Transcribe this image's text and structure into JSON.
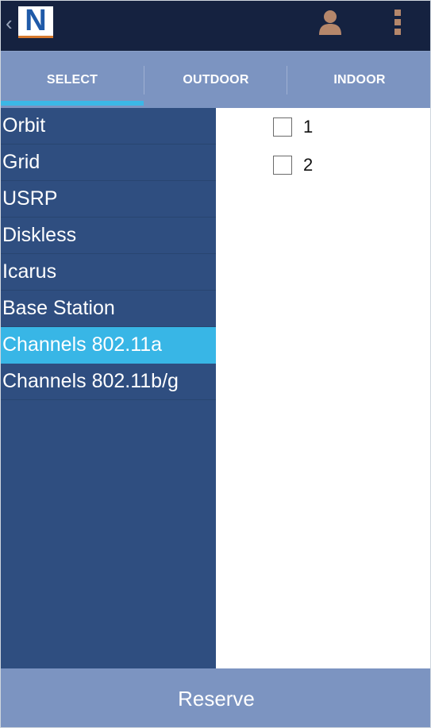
{
  "actionbar": {
    "logo_letter": "N",
    "up_glyph": "‹",
    "icons": {
      "up": "chevron-left-icon",
      "logo": "app-logo",
      "user": "user-icon",
      "overflow": "overflow-menu-icon"
    }
  },
  "tabs": [
    {
      "label": "SELECT",
      "selected": true
    },
    {
      "label": "OUTDOOR",
      "selected": false
    },
    {
      "label": "INDOOR",
      "selected": false
    }
  ],
  "list": {
    "items": [
      {
        "label": "Orbit"
      },
      {
        "label": "Grid"
      },
      {
        "label": "USRP"
      },
      {
        "label": "Diskless"
      },
      {
        "label": "Icarus"
      },
      {
        "label": "Base Station"
      },
      {
        "label": "Channels 802.11a",
        "selected": true
      },
      {
        "label": "Channels 802.11b/g"
      }
    ]
  },
  "detail": {
    "options": [
      {
        "label": "1",
        "checked": false
      },
      {
        "label": "2",
        "checked": false
      }
    ]
  },
  "footer": {
    "reserve_label": "Reserve"
  },
  "colors": {
    "actionbar": "#152240",
    "tabbar": "#7c94c1",
    "tab_indicator": "#3cb7e6",
    "list_bg": "#2f4e80",
    "list_selected": "#38b6e6",
    "reserve_bg": "#7c94c1",
    "user_icon": "#b5876b"
  }
}
